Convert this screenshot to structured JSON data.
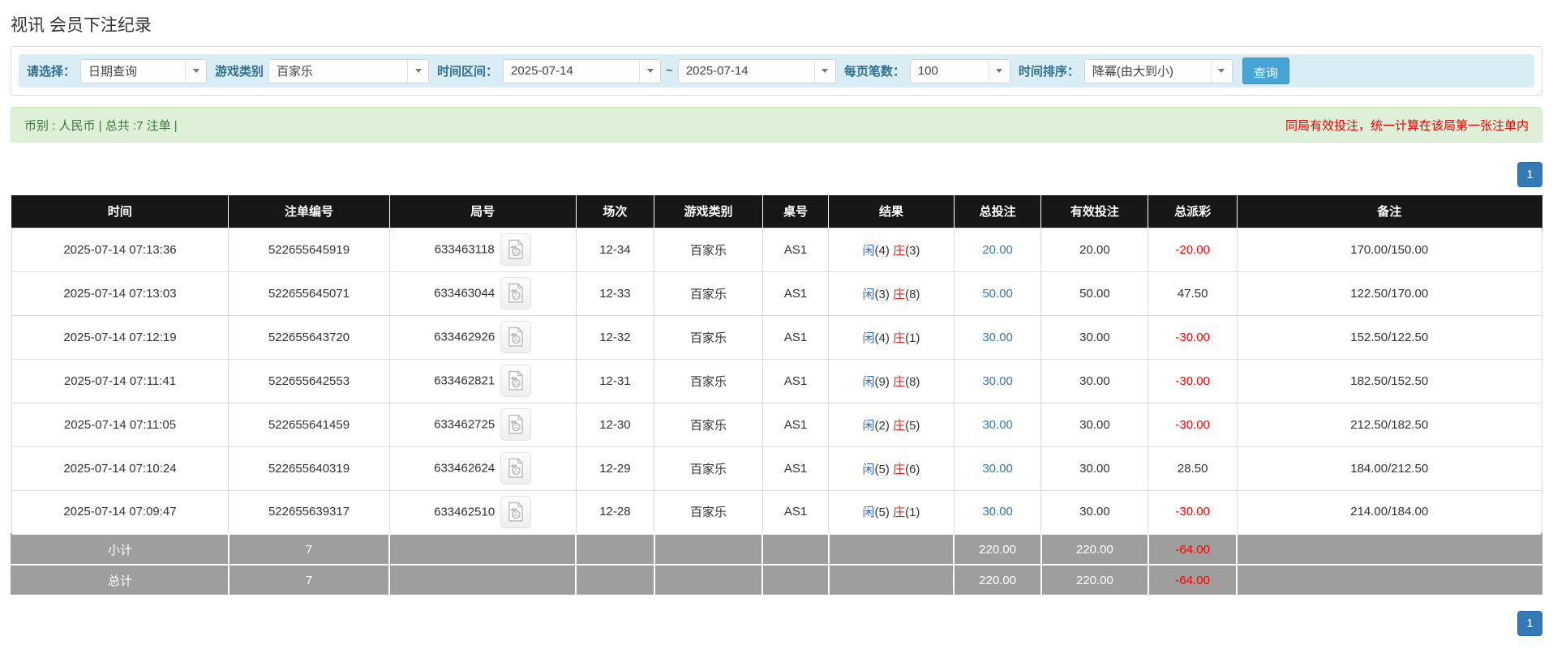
{
  "page": {
    "title": "视讯 会员下注纪录"
  },
  "filters": {
    "select_label": "请选择：",
    "select_value": "日期查询",
    "game_type_label": "游戏类别",
    "game_type_value": "百家乐",
    "date_range_label": "时间区间：",
    "date_from": "2025-07-14",
    "date_separator": "~",
    "date_to": "2025-07-14",
    "page_size_label": "每页笔数：",
    "page_size_value": "100",
    "sort_label": "时间排序：",
    "sort_value": "降冪(由大到小)",
    "search_button": "查询"
  },
  "summary": {
    "left": "币别 : 人民币 | 总共 :7 注单 |",
    "right": "同局有效投注，统一计算在该局第一张注单内"
  },
  "pagination": {
    "page": "1"
  },
  "table": {
    "headers": [
      "时间",
      "注单编号",
      "局号",
      "场次",
      "游戏类别",
      "桌号",
      "结果",
      "总投注",
      "有效投注",
      "总派彩",
      "备注"
    ],
    "rows": [
      {
        "time": "2025-07-14 07:13:36",
        "bet_id": "522655645919",
        "round_id": "633463118",
        "session": "12-34",
        "game": "百家乐",
        "table_no": "AS1",
        "result": {
          "player_label": "闲",
          "player_value": "(4)",
          "banker_label": "庄",
          "banker_value": "(3)"
        },
        "total_bet": "20.00",
        "valid_bet": "20.00",
        "payout": "-20.00",
        "remark": "170.00/150.00"
      },
      {
        "time": "2025-07-14 07:13:03",
        "bet_id": "522655645071",
        "round_id": "633463044",
        "session": "12-33",
        "game": "百家乐",
        "table_no": "AS1",
        "result": {
          "player_label": "闲",
          "player_value": "(3)",
          "banker_label": "庄",
          "banker_value": "(8)"
        },
        "total_bet": "50.00",
        "valid_bet": "50.00",
        "payout": "47.50",
        "remark": "122.50/170.00"
      },
      {
        "time": "2025-07-14 07:12:19",
        "bet_id": "522655643720",
        "round_id": "633462926",
        "session": "12-32",
        "game": "百家乐",
        "table_no": "AS1",
        "result": {
          "player_label": "闲",
          "player_value": "(4)",
          "banker_label": "庄",
          "banker_value": "(1)"
        },
        "total_bet": "30.00",
        "valid_bet": "30.00",
        "payout": "-30.00",
        "remark": "152.50/122.50"
      },
      {
        "time": "2025-07-14 07:11:41",
        "bet_id": "522655642553",
        "round_id": "633462821",
        "session": "12-31",
        "game": "百家乐",
        "table_no": "AS1",
        "result": {
          "player_label": "闲",
          "player_value": "(9)",
          "banker_label": "庄",
          "banker_value": "(8)"
        },
        "total_bet": "30.00",
        "valid_bet": "30.00",
        "payout": "-30.00",
        "remark": "182.50/152.50"
      },
      {
        "time": "2025-07-14 07:11:05",
        "bet_id": "522655641459",
        "round_id": "633462725",
        "session": "12-30",
        "game": "百家乐",
        "table_no": "AS1",
        "result": {
          "player_label": "闲",
          "player_value": "(2)",
          "banker_label": "庄",
          "banker_value": "(5)"
        },
        "total_bet": "30.00",
        "valid_bet": "30.00",
        "payout": "-30.00",
        "remark": "212.50/182.50"
      },
      {
        "time": "2025-07-14 07:10:24",
        "bet_id": "522655640319",
        "round_id": "633462624",
        "session": "12-29",
        "game": "百家乐",
        "table_no": "AS1",
        "result": {
          "player_label": "闲",
          "player_value": "(5)",
          "banker_label": "庄",
          "banker_value": "(6)"
        },
        "total_bet": "30.00",
        "valid_bet": "30.00",
        "payout": "28.50",
        "remark": "184.00/212.50"
      },
      {
        "time": "2025-07-14 07:09:47",
        "bet_id": "522655639317",
        "round_id": "633462510",
        "session": "12-28",
        "game": "百家乐",
        "table_no": "AS1",
        "result": {
          "player_label": "闲",
          "player_value": "(5)",
          "banker_label": "庄",
          "banker_value": "(1)"
        },
        "total_bet": "30.00",
        "valid_bet": "30.00",
        "payout": "-30.00",
        "remark": "214.00/184.00"
      }
    ],
    "footer": [
      {
        "label": "小计",
        "count": "7",
        "total_bet": "220.00",
        "valid_bet": "220.00",
        "payout": "-64.00"
      },
      {
        "label": "总计",
        "count": "7",
        "total_bet": "220.00",
        "valid_bet": "220.00",
        "payout": "-64.00"
      }
    ]
  }
}
